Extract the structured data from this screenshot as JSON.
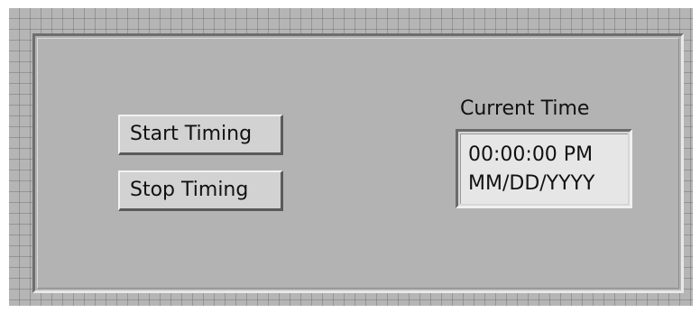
{
  "buttons": {
    "start_label": "Start Timing",
    "stop_label": "Stop Timing"
  },
  "current_time": {
    "label": "Current Time",
    "time": "00:00:00 PM",
    "date": "MM/DD/YYYY"
  },
  "colors": {
    "panel_background": "#b5b5b5",
    "grid_line": "#787878",
    "button_face": "#d2d2d2",
    "indicator_face": "#e6e6e6",
    "text": "#111111"
  }
}
